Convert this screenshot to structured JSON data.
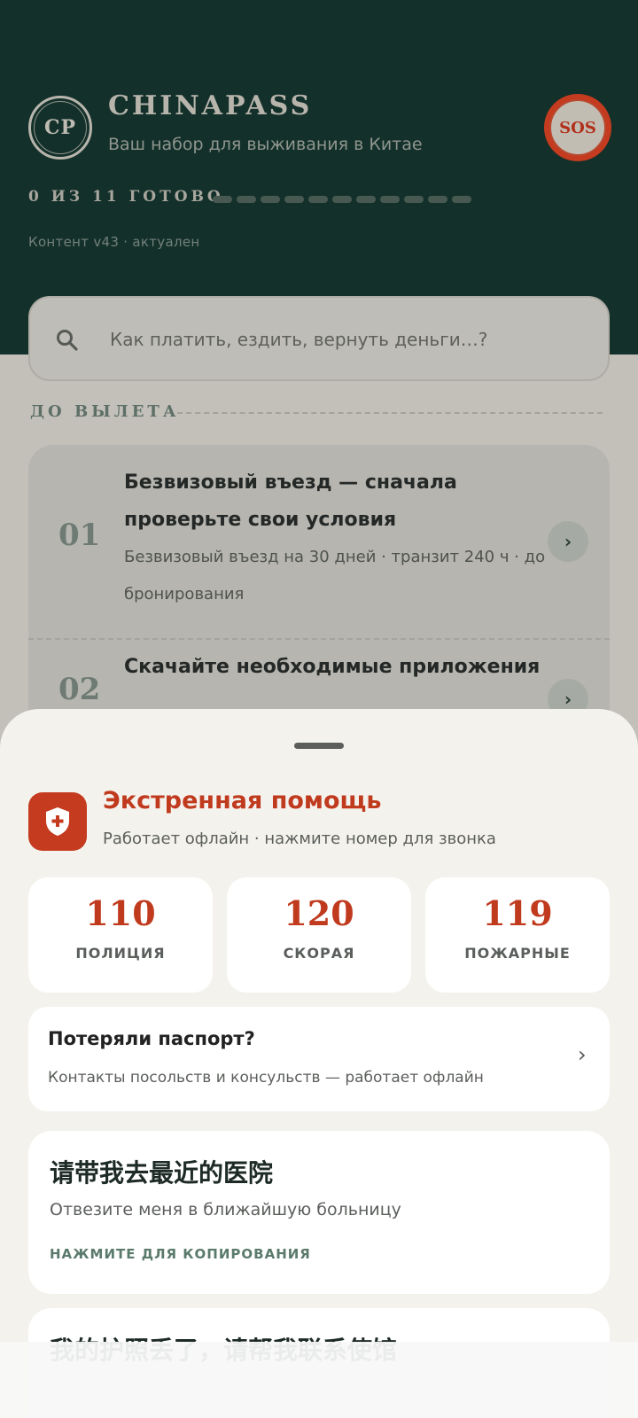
{
  "header": {
    "logo_text": "CP",
    "title": "CHINAPASS",
    "subtitle": "Ваш набор для выживания в Китае",
    "sos_label": "SOS",
    "progress_label": "0 ИЗ 11 ГОТОВО",
    "progress": {
      "done": 0,
      "total": 11
    },
    "content_version": "Контент v43 · актуален"
  },
  "search": {
    "placeholder": "Как платить, ездить, вернуть деньги…?",
    "icon": "search-icon"
  },
  "section": {
    "title": "ДО ВЫЛЕТА",
    "steps": [
      {
        "number": "01",
        "title": "Безвизовый въезд — сначала проверьте свои условия",
        "description": "Безвизовый въезд на 30 дней · транзит 240 ч · до бронирования",
        "chevron": "›"
      },
      {
        "number": "02",
        "title": "Скачайте необходимые приложения",
        "description": "",
        "chevron": "›"
      }
    ]
  },
  "emergency": {
    "icon": "shield-plus-icon",
    "title": "Экстренная помощь",
    "subtitle": "Работает офлайн · нажмите номер для звонка",
    "numbers": [
      {
        "number": "110",
        "label": "ПОЛИЦИЯ"
      },
      {
        "number": "120",
        "label": "СКОРАЯ"
      },
      {
        "number": "119",
        "label": "ПОЖАРНЫЕ"
      }
    ],
    "passport": {
      "title": "Потеряли паспорт?",
      "subtitle": "Контакты посольств и консульств — работает офлайн",
      "chevron": "›"
    },
    "phrases": [
      {
        "zh": "请带我去最近的医院",
        "ru": "Отвезите меня в ближайшую больницу",
        "copy_label": "НАЖМИТЕ ДЛЯ КОПИРОВАНИЯ"
      },
      {
        "zh": "我的护照丢了，请帮我联系使馆",
        "ru": "",
        "copy_label": ""
      }
    ]
  },
  "colors": {
    "header_bg": "#13312a",
    "accent_red": "#c43b1f",
    "sheet_bg": "#f4f2ed",
    "muted_green": "#5a7a6c"
  }
}
